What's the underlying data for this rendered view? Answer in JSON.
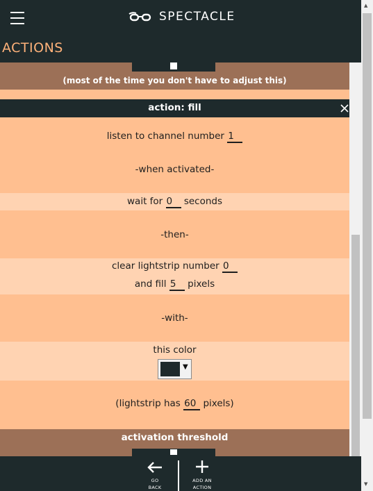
{
  "app": {
    "name": "SPECTACLE"
  },
  "section": {
    "title": "ACTIONS"
  },
  "adjust_note": "(most of the time you don't have to adjust this)",
  "action": {
    "title": "action: fill",
    "channel_prefix": "listen to channel number",
    "channel_value": "1",
    "when_activated": "-when activated-",
    "wait_prefix": "wait for",
    "wait_value": "0",
    "wait_suffix": "seconds",
    "then": "-then-",
    "clear_prefix": "clear lightstrip number",
    "clear_value": "0",
    "fill_prefix": "and fill",
    "fill_value": "5",
    "fill_suffix": "pixels",
    "with": "-with-",
    "color_label": "this color",
    "color_value": "#1e2a2c",
    "pixels_prefix": "(lightstrip has",
    "pixels_value": "60",
    "pixels_suffix": "pixels)"
  },
  "threshold": {
    "title": "activation threshold"
  },
  "bottom": {
    "go_back_line1": "GO",
    "go_back_line2": "BACK",
    "add_line1": "ADD AN",
    "add_line2": "ACTION"
  },
  "icons": {
    "menu": "hamburger-menu-icon",
    "logo": "glasses-icon",
    "close": "close-icon",
    "back": "arrow-left-icon",
    "add": "plus-icon",
    "dropdown": "triangle-down-icon"
  },
  "colors": {
    "bar": "#1e2a2c",
    "accent": "#ffb27a",
    "panel": "#ffbf90",
    "panel_light": "#ffd3b2",
    "band": "#9c7057"
  }
}
